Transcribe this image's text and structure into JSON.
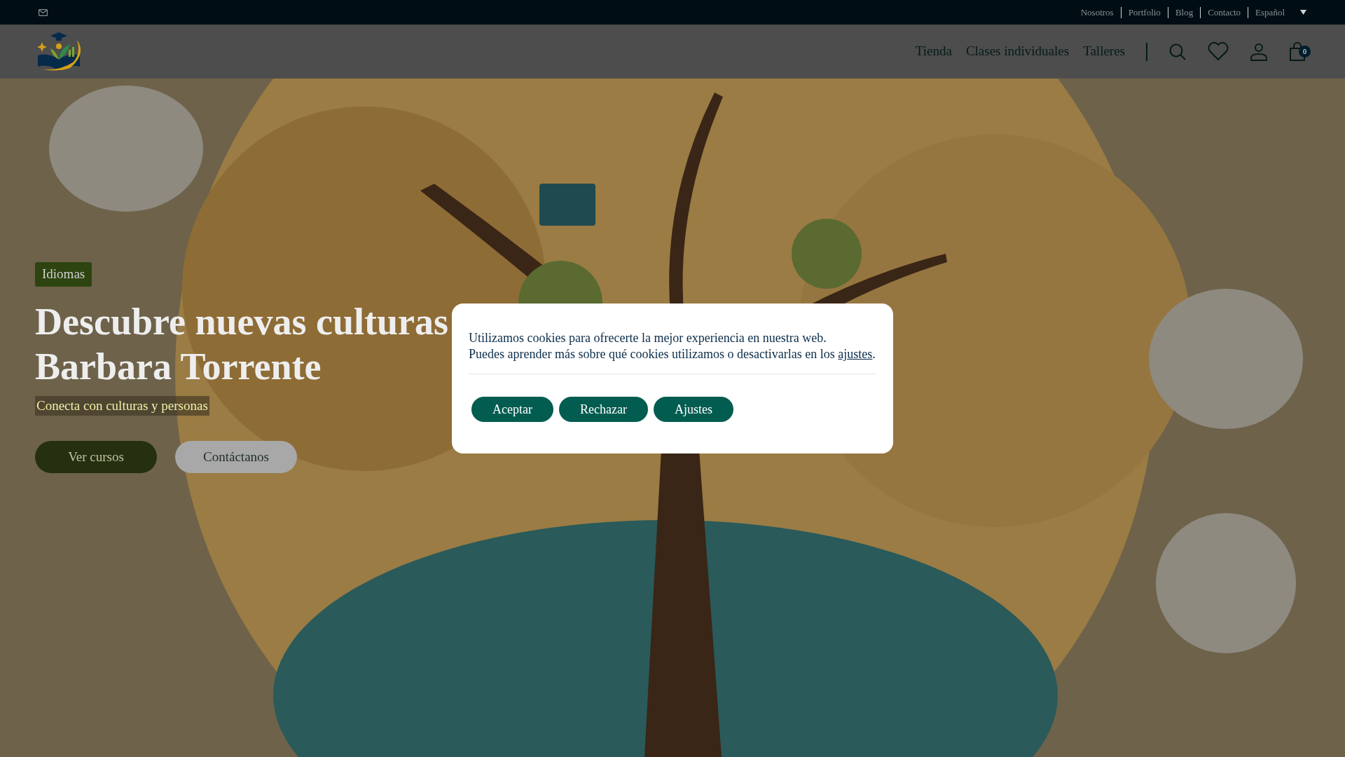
{
  "top_bar": {
    "links": [
      "Nosotros",
      "Portfolio",
      "Blog",
      "Contacto"
    ],
    "language": "Español"
  },
  "header": {
    "nav": [
      "Tienda",
      "Clases individuales",
      "Talleres"
    ],
    "cart_count": "0"
  },
  "hero": {
    "tag": "Idiomas",
    "title_lines": [
      "Descubre nuevas culturas",
      "Barbara Torrente"
    ],
    "subtitle": "Conecta con culturas y personas",
    "buttons": [
      {
        "label": "Ver cursos",
        "kind": "primary"
      },
      {
        "label": "Contáctanos",
        "kind": "secondary"
      }
    ]
  },
  "cookie_banner": {
    "message_lines": [
      "Utilizamos cookies para ofrecerte la mejor experiencia en nuestra web.",
      "Puedes aprender más sobre qué cookies utilizamos o desactivarlas en los"
    ],
    "settings_link": "ajustes",
    "link_suffix": ".",
    "buttons": [
      "Aceptar",
      "Rechazar",
      "Ajustes"
    ]
  }
}
